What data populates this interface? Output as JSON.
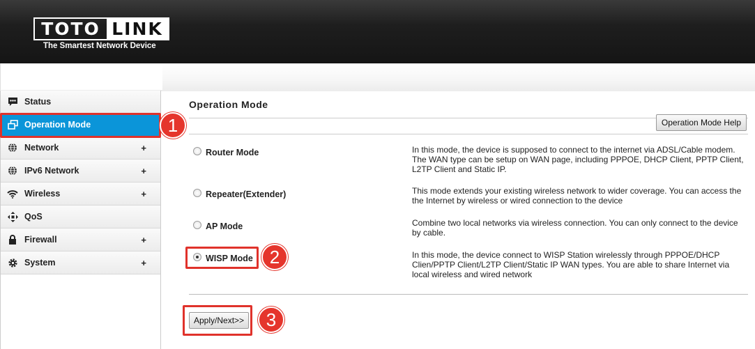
{
  "header": {
    "logo_left": "TOTO",
    "logo_right": "LINK",
    "tagline": "The Smartest Network Device",
    "background": "#1e1e1e"
  },
  "sidebar": {
    "active_color": "#0b95d9",
    "items": [
      {
        "label": "Status",
        "icon": "status-icon",
        "expandable": false,
        "active": false
      },
      {
        "label": "Operation Mode",
        "icon": "operation-mode-icon",
        "expandable": false,
        "active": true
      },
      {
        "label": "Network",
        "icon": "globe-icon",
        "expandable": true,
        "active": false
      },
      {
        "label": "IPv6 Network",
        "icon": "globe-icon",
        "expandable": true,
        "active": false
      },
      {
        "label": "Wireless",
        "icon": "wifi-icon",
        "expandable": true,
        "active": false
      },
      {
        "label": "QoS",
        "icon": "qos-icon",
        "expandable": false,
        "active": false
      },
      {
        "label": "Firewall",
        "icon": "lock-icon",
        "expandable": true,
        "active": false
      },
      {
        "label": "System",
        "icon": "gear-icon",
        "expandable": true,
        "active": false
      }
    ],
    "plus_symbol": "+"
  },
  "main": {
    "title": "Operation Mode",
    "help_button": "Operation Mode Help",
    "modes": [
      {
        "label": "Router Mode",
        "selected": false,
        "description": "In this mode, the device is supposed to connect to the internet via ADSL/Cable modem. The WAN type can be setup on WAN page, including PPPOE, DHCP Client, PPTP Client, L2TP Client and Static IP."
      },
      {
        "label": "Repeater(Extender)",
        "selected": false,
        "description": "This mode extends your existing wireless network to wider coverage. You can access the the Internet by wireless or wired connection to the device"
      },
      {
        "label": "AP Mode",
        "selected": false,
        "description": "Combine two local networks via wireless connection. You can only connect to the device by cable."
      },
      {
        "label": "WISP Mode",
        "selected": true,
        "description": "In this mode, the device connect to WISP Station wirelessly through PPPOE/DHCP Clien/PPTP Client/L2TP Client/Static IP WAN types. You are able to share Internet via local wireless and wired network"
      }
    ],
    "apply_button": "Apply/Next>>"
  },
  "annotations": {
    "color": "#e0322b",
    "steps": [
      "1",
      "2",
      "3"
    ]
  }
}
